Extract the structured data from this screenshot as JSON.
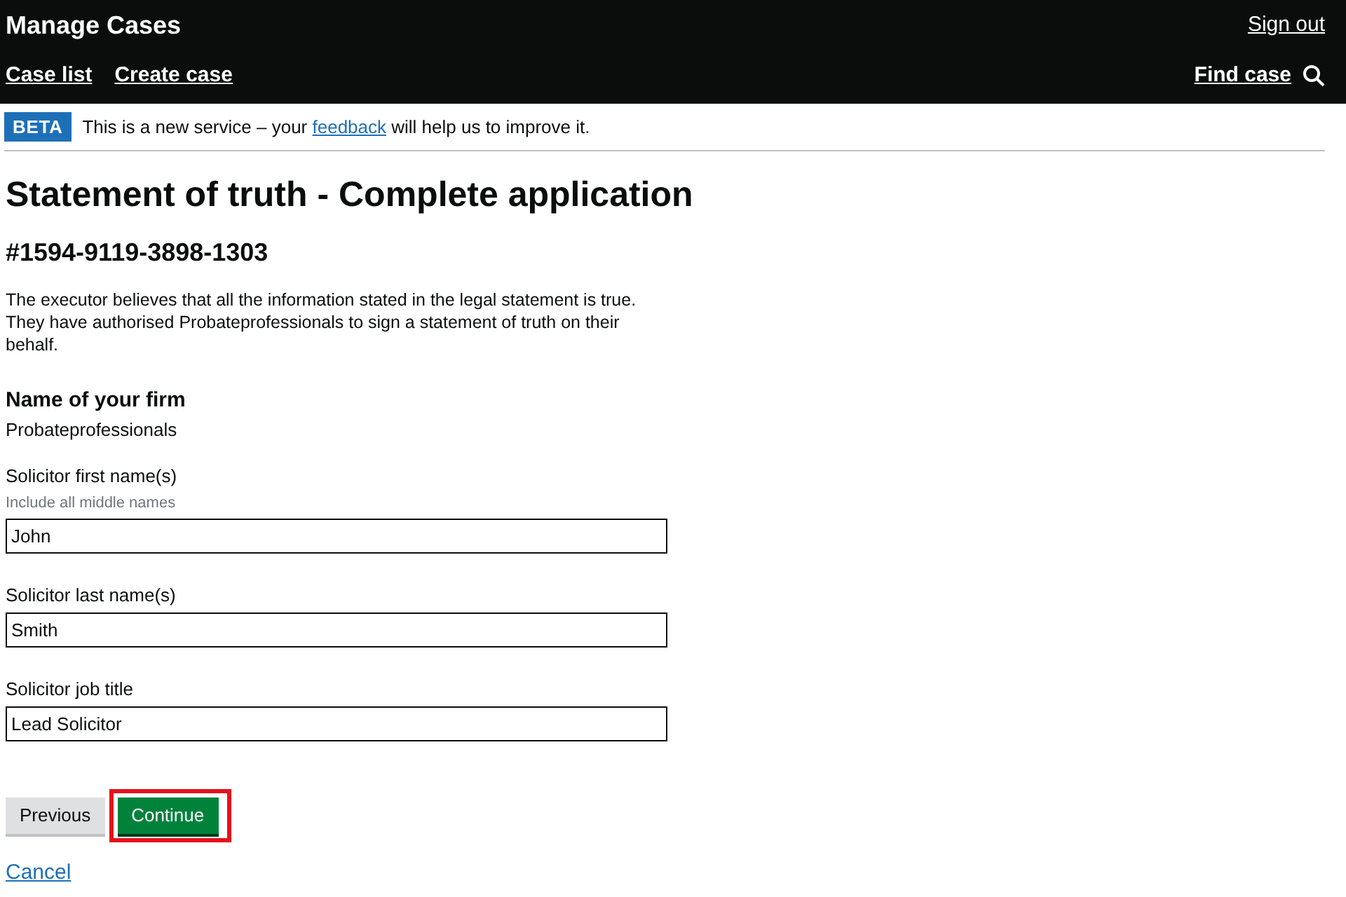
{
  "header": {
    "title": "Manage Cases",
    "sign_out": "Sign out",
    "nav": [
      "Case list",
      "Create case"
    ],
    "find_case": "Find case"
  },
  "beta": {
    "tag": "BETA",
    "text_before": "This is a new service – your ",
    "link": "feedback",
    "text_after": " will help us to improve it."
  },
  "heading": "Statement of truth - Complete application",
  "case_number": "#1594-9119-3898-1303",
  "intro": "The executor believes that all the information stated in the legal statement is true. They have authorised Probateprofessionals to sign a statement of truth on their behalf.",
  "firm": {
    "label": "Name of your firm",
    "value": "Probateprofessionals"
  },
  "fields": [
    {
      "label": "Solicitor first name(s)",
      "hint": "Include all middle names",
      "value": "John"
    },
    {
      "label": "Solicitor last name(s)",
      "value": "Smith"
    },
    {
      "label": "Solicitor job title",
      "value": "Lead Solicitor"
    }
  ],
  "buttons": [
    {
      "label": "Previous",
      "kind": "secondary",
      "highlighted": false
    },
    {
      "label": "Continue",
      "kind": "primary",
      "highlighted": true
    }
  ],
  "cancel": "Cancel"
}
